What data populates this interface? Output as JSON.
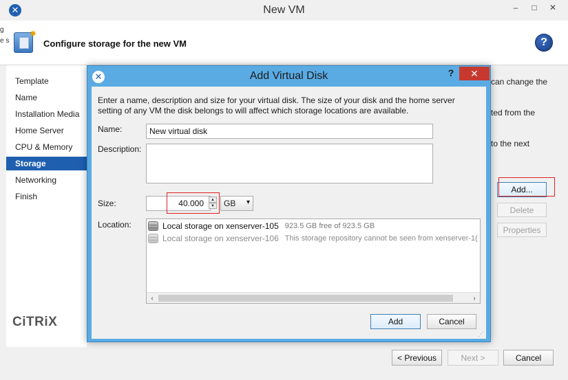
{
  "window": {
    "title": "New VM",
    "controls": {
      "minimize": "–",
      "maximize": "□",
      "close": "✕"
    }
  },
  "header": {
    "title": "Configure storage for the new VM",
    "help_icon": "?",
    "left_fragment_1": "g",
    "left_fragment_2": "e s"
  },
  "nav": {
    "items": [
      {
        "label": "Template",
        "active": false
      },
      {
        "label": "Name",
        "active": false
      },
      {
        "label": "Installation Media",
        "active": false
      },
      {
        "label": "Home Server",
        "active": false
      },
      {
        "label": "CPU & Memory",
        "active": false
      },
      {
        "label": "Storage",
        "active": true
      },
      {
        "label": "Networking",
        "active": false
      },
      {
        "label": "Finish",
        "active": false
      }
    ],
    "logo": "CiTRiX"
  },
  "background_text": {
    "line1": "can change the",
    "line2": "ted from the",
    "line3": "to the next"
  },
  "side_buttons": {
    "add": "Add...",
    "delete": "Delete",
    "properties": "Properties"
  },
  "wizard_buttons": {
    "previous": "< Previous",
    "next": "Next >",
    "cancel": "Cancel"
  },
  "dialog": {
    "title": "Add Virtual Disk",
    "help": "?",
    "close": "✕",
    "intro": "Enter a name, description and size for your virtual disk. The size of your disk and the home server setting of any VM the disk belongs to will affect which storage locations are available.",
    "name_label": "Name:",
    "name_value": "New virtual disk",
    "description_label": "Description:",
    "description_value": "",
    "size_label": "Size:",
    "size_value": "40.000",
    "size_unit": "GB",
    "location_label": "Location:",
    "locations": [
      {
        "name": "Local storage on xenserver-105",
        "detail": "923.5 GB free of 923.5 GB",
        "enabled": true
      },
      {
        "name": "Local storage on xenserver-106",
        "detail": "This storage repository cannot be seen from xenserver-1(",
        "enabled": false
      }
    ],
    "add_button": "Add",
    "cancel_button": "Cancel"
  },
  "colors": {
    "accent": "#1f5fb0",
    "dialog_frame": "#5aabe3",
    "close_red": "#c7392f",
    "highlight_red": "#e02020"
  }
}
